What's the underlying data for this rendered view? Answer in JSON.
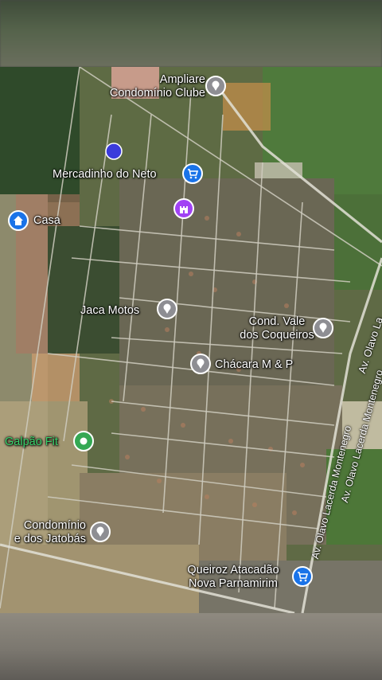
{
  "places": [
    {
      "label_line1": "Ampliare",
      "label_line2": "Condomínio Clube",
      "icon": "pin-gray-icon"
    },
    {
      "label": "Mercadinho do Neto",
      "icon": "shopping-cart-icon"
    },
    {
      "label": "Casa",
      "icon": "home-icon"
    },
    {
      "label": "Jaca Motos",
      "icon": "pin-gray-icon"
    },
    {
      "label_line1": "Cond. Vale",
      "label_line2": "dos Coqueiros",
      "icon": "pin-gray-icon"
    },
    {
      "label": "Chácara M & P",
      "icon": "pin-gray-icon"
    },
    {
      "label": "Galpão Fit",
      "icon": "fitness-icon"
    },
    {
      "label_line1": "Condomínio",
      "label_line2": "e dos Jatobás",
      "icon": "pin-gray-icon"
    },
    {
      "label_line1": "Queiroz Atacadão",
      "label_line2": "Nova Parnamirim",
      "icon": "shopping-cart-icon"
    },
    {
      "label": "",
      "icon": "castle-icon"
    }
  ],
  "roads": {
    "olavo_upper": "Av. Olavo La",
    "olavo_middle": "Av. Olavo Lacerda Montenegro",
    "olavo_lower": "Av. Olavo Lacerda Montenegro"
  },
  "colors": {
    "pin_gray": "#8e8e93",
    "pin_blue": "#1a73e8",
    "pin_purple": "#a142f4",
    "pin_green": "#34a853",
    "location_dot": "#3b3bdb"
  }
}
